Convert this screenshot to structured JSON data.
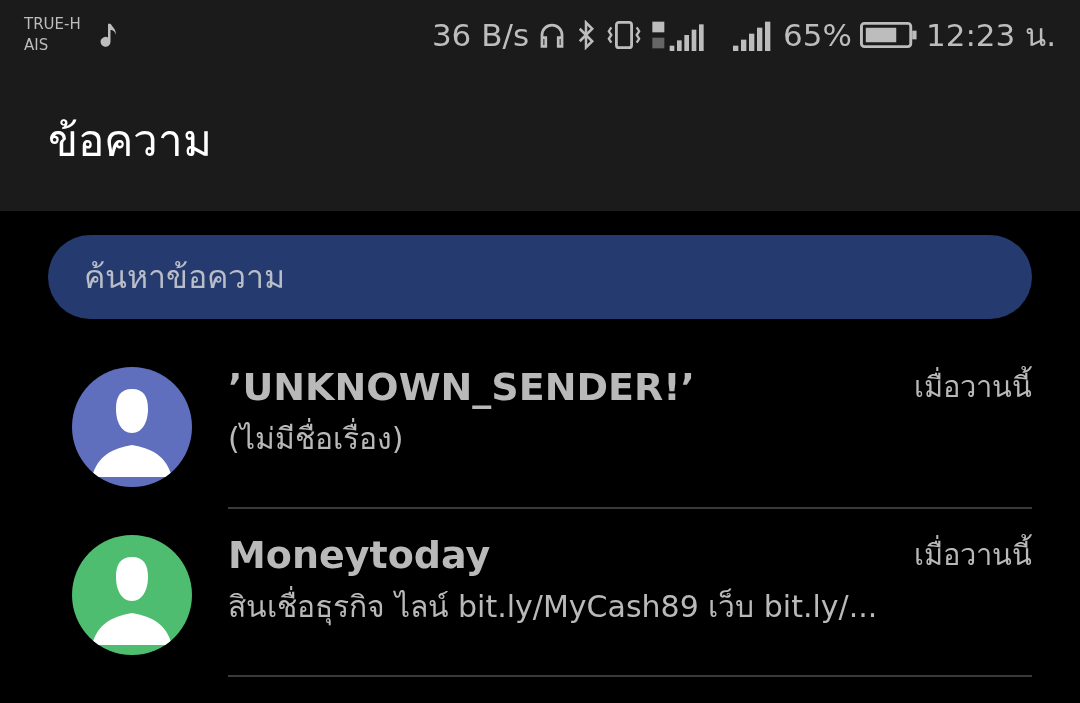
{
  "status_bar": {
    "carrier_1": "TRUE-H",
    "carrier_2": "AIS",
    "speed": "36 B/s",
    "battery": "65%",
    "time": "12:23 น."
  },
  "header": {
    "title": "ข้อความ"
  },
  "search": {
    "placeholder": "ค้นหาข้อความ"
  },
  "conversations": [
    {
      "sender": "’UNKNOWN_SENDER!’",
      "preview": "(ไม่มีชื่อเรื่อง)",
      "time": "เมื่อวานนี้",
      "color": "#5f6fbd"
    },
    {
      "sender": "Moneytoday",
      "preview": "สินเชื่อธุรกิจ ไลน์ bit.ly/MyCash89 เว็บ bit.ly/...",
      "time": "เมื่อวานนี้",
      "color": "#4fbd6f"
    }
  ]
}
